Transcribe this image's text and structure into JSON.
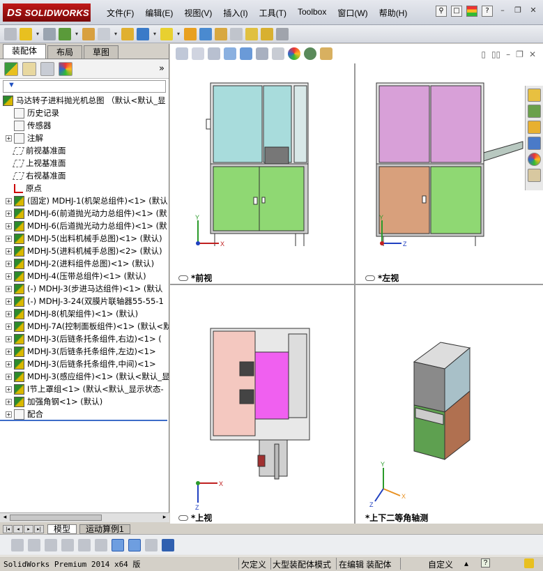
{
  "app": {
    "logo_prefix": "DS",
    "logo_text": "SOLIDWORKS"
  },
  "menu": [
    "文件(F)",
    "编辑(E)",
    "视图(V)",
    "插入(I)",
    "工具(T)",
    "Toolbox",
    "窗口(W)",
    "帮助(H)"
  ],
  "left_tabs": [
    "装配体",
    "布局",
    "草图"
  ],
  "filter": {
    "symbol": "▼"
  },
  "tree": [
    {
      "label": "马达转子进料抛光机总图  （默认<默认_显",
      "icon": "asm",
      "expand": "",
      "level": 0
    },
    {
      "label": "历史记录",
      "icon": "feat",
      "expand": "",
      "level": 1
    },
    {
      "label": "传感器",
      "icon": "feat",
      "expand": "",
      "level": 1
    },
    {
      "label": "注解",
      "icon": "feat",
      "expand": "+",
      "level": 1
    },
    {
      "label": "前视基准面",
      "icon": "plane",
      "expand": "",
      "level": 1
    },
    {
      "label": "上视基准面",
      "icon": "plane",
      "expand": "",
      "level": 1
    },
    {
      "label": "右视基准面",
      "icon": "plane",
      "expand": "",
      "level": 1
    },
    {
      "label": "原点",
      "icon": "origin",
      "expand": "",
      "level": 1
    },
    {
      "label": "(固定) MDHJ-1(机架总组件)<1> (默认",
      "icon": "asm",
      "expand": "+",
      "level": 1
    },
    {
      "label": "MDHJ-6(前道抛光动力总组件)<1> (默",
      "icon": "asm",
      "expand": "+",
      "level": 1
    },
    {
      "label": "MDHJ-6(后道抛光动力总组件)<1> (默",
      "icon": "asm",
      "expand": "+",
      "level": 1
    },
    {
      "label": "MDHJ-5(出料机械手总图)<1> (默认)",
      "icon": "asm",
      "expand": "+",
      "level": 1
    },
    {
      "label": "MDHJ-5(进料机械手总图)<2> (默认)",
      "icon": "asm",
      "expand": "+",
      "level": 1
    },
    {
      "label": "MDHJ-2(进料组件总图)<1> (默认)",
      "icon": "asm",
      "expand": "+",
      "level": 1
    },
    {
      "label": "MDHJ-4(压带总组件)<1> (默认)",
      "icon": "asm",
      "expand": "+",
      "level": 1
    },
    {
      "label": "(-) MDHJ-3(步进马达组件)<1> (默认",
      "icon": "asm",
      "expand": "+",
      "level": 1
    },
    {
      "label": "(-) MDHJ-3-24(双膜片联轴器55-55-1",
      "icon": "asm",
      "expand": "+",
      "level": 1
    },
    {
      "label": "MDHJ-8(机架组件)<1> (默认)",
      "icon": "asm",
      "expand": "+",
      "level": 1
    },
    {
      "label": "MDHJ-7A(控制面板组件)<1> (默认<默",
      "icon": "asm",
      "expand": "+",
      "level": 1
    },
    {
      "label": "MDHJ-3(后链条托条组件,右边)<1> (",
      "icon": "asm",
      "expand": "+",
      "level": 1
    },
    {
      "label": "MDHJ-3(后链条托条组件,左边)<1>",
      "icon": "asm",
      "expand": "+",
      "level": 1
    },
    {
      "label": "MDHJ-3(后链条托条组件,中间)<1>",
      "icon": "asm",
      "expand": "+",
      "level": 1
    },
    {
      "label": "MDHJ-3(感应组件)<1> (默认<默认_显",
      "icon": "asm",
      "expand": "+",
      "level": 1
    },
    {
      "label": "I节上罩组<1> (默认<默认_显示状态-",
      "icon": "asm",
      "expand": "+",
      "level": 1
    },
    {
      "label": "加强角钢<1> (默认)",
      "icon": "asm",
      "expand": "+",
      "level": 1
    },
    {
      "label": "配合",
      "icon": "feat",
      "expand": "+",
      "level": 1
    }
  ],
  "views": [
    {
      "id": "front",
      "label": "*前视"
    },
    {
      "id": "left",
      "label": "*左视"
    },
    {
      "id": "top",
      "label": "*上视"
    },
    {
      "id": "iso",
      "label": "*上下二等角轴测"
    }
  ],
  "axes": {
    "x": "X",
    "y": "Y",
    "z": "Z"
  },
  "bottom_tabs": [
    "模型",
    "运动算例1"
  ],
  "status": {
    "product": "SolidWorks Premium 2014 x64 版",
    "undefined": "欠定义",
    "mode": "大型装配体模式",
    "editing": "在编辑 装配体",
    "custom": "自定义",
    "help": "?"
  },
  "colors": {
    "cyan_panel": "#a8dcdc",
    "green_panel": "#8fd873",
    "purple_panel": "#d8a0d8",
    "tan_panel": "#d8a07c",
    "pink_panel": "#f4c8c0",
    "magenta": "#f060f0"
  }
}
